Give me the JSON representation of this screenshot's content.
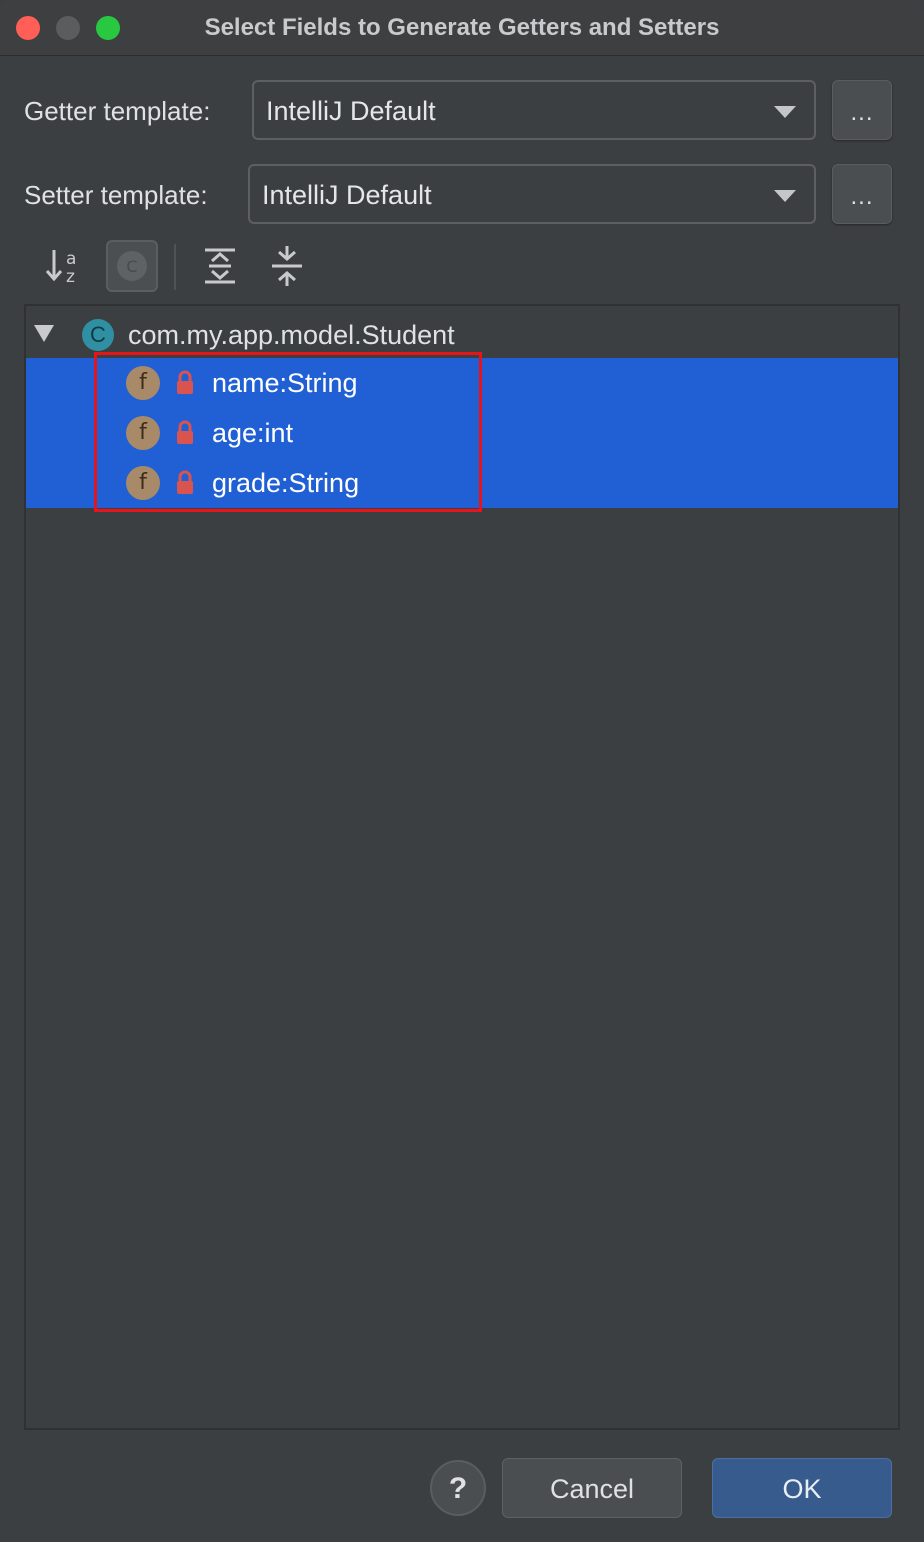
{
  "window": {
    "title": "Select Fields to Generate Getters and Setters"
  },
  "getter": {
    "label": "Getter template:",
    "value": "IntelliJ Default",
    "more_label": "..."
  },
  "setter": {
    "label": "Setter template:",
    "value": "IntelliJ Default",
    "more_label": "..."
  },
  "toolbar": {
    "icons": [
      "sort-alphabetically-icon",
      "show-classes-icon",
      "expand-all-icon",
      "collapse-all-icon"
    ]
  },
  "tree": {
    "root": {
      "icon_letter": "C",
      "label": "com.my.app.model.Student"
    },
    "fields": [
      {
        "icon_letter": "f",
        "label": "name:String"
      },
      {
        "icon_letter": "f",
        "label": "age:int"
      },
      {
        "icon_letter": "f",
        "label": "grade:String"
      }
    ]
  },
  "footer": {
    "help_label": "?",
    "cancel_label": "Cancel",
    "ok_label": "OK"
  },
  "colors": {
    "selection": "#2060d4",
    "highlight_box": "#e8141c",
    "class_icon": "#2f8fa3",
    "field_icon": "#a88a68",
    "lock": "#d9534f"
  }
}
